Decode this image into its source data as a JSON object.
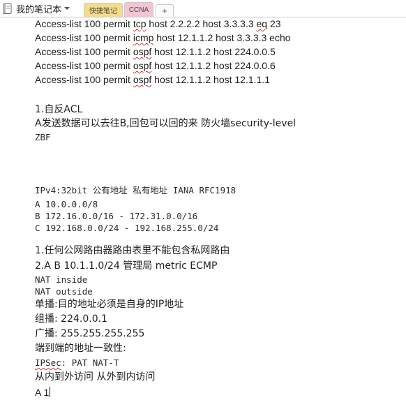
{
  "toolbar": {
    "notebook_name": "我的笔记本",
    "tabs": [
      {
        "label": "快捷笔记",
        "color": "#f5dc8a"
      },
      {
        "label": "CCNA",
        "color": "#f4c4d4"
      }
    ],
    "add_tab_label": "+"
  },
  "note": {
    "acl": [
      {
        "pre": "Access-list 100 permit ",
        "kw": "tcp",
        "mid": " host 2.2.2.2 host 3.3.3.3 ",
        "kw2": "eq",
        "post": " 23"
      },
      {
        "pre": "Access-list 100 permit ",
        "kw": "icmp",
        "mid": " host 12.1.1.2 host 3.3.3.3 echo",
        "kw2": "",
        "post": ""
      },
      {
        "pre": "Access-list 100 permit ",
        "kw": "ospf",
        "mid": " host 12.1.1.2 host 224.0.0.5",
        "kw2": "",
        "post": ""
      },
      {
        "pre": "Access-list 100 permit ",
        "kw": "ospf",
        "mid": " host 12.1.1.2 host 224.0.0.6",
        "kw2": "",
        "post": ""
      },
      {
        "pre": "Access-list 100 permit ",
        "kw": "ospf",
        "mid": " host 12.1.1.2 host 12.1.1.1",
        "kw2": "",
        "post": ""
      }
    ],
    "reflexive_heading": "1.自反ACL",
    "reflexive_desc": "A发送数据可以去往B,回包可以回的来 防火墙security-level",
    "zbf": "ZBF",
    "ipv4_line": "IPv4:32bit   公有地址   私有地址 IANA  RFC1918",
    "class_a": "A 10.0.0.0/8",
    "class_b": "B 172.16.0.0/16 - 172.31.0.0/16",
    "class_c": "C 192.168.0.0/24 - 192.168.255.0/24",
    "rule_1": "1.任何公网路由器路由表里不能包含私网路由",
    "rule_2": "2.A B  10.1.1.0/24 管理局 metric   ECMP",
    "nat_inside": "NAT inside",
    "nat_outside": "NAT outside",
    "unicast": "单播:目的地址必须是自身的IP地址",
    "multicast": "组播: 224.0.0.1",
    "broadcast": "广播: 255.255.255.255",
    "consistency": "端到端的地址一致性:",
    "ipsec_word": "IPSec",
    "ipsec_rest": ":   PAT   NAT-T",
    "access_dir": "从内到外访问 从外到内访问",
    "last_line": "A 1"
  }
}
